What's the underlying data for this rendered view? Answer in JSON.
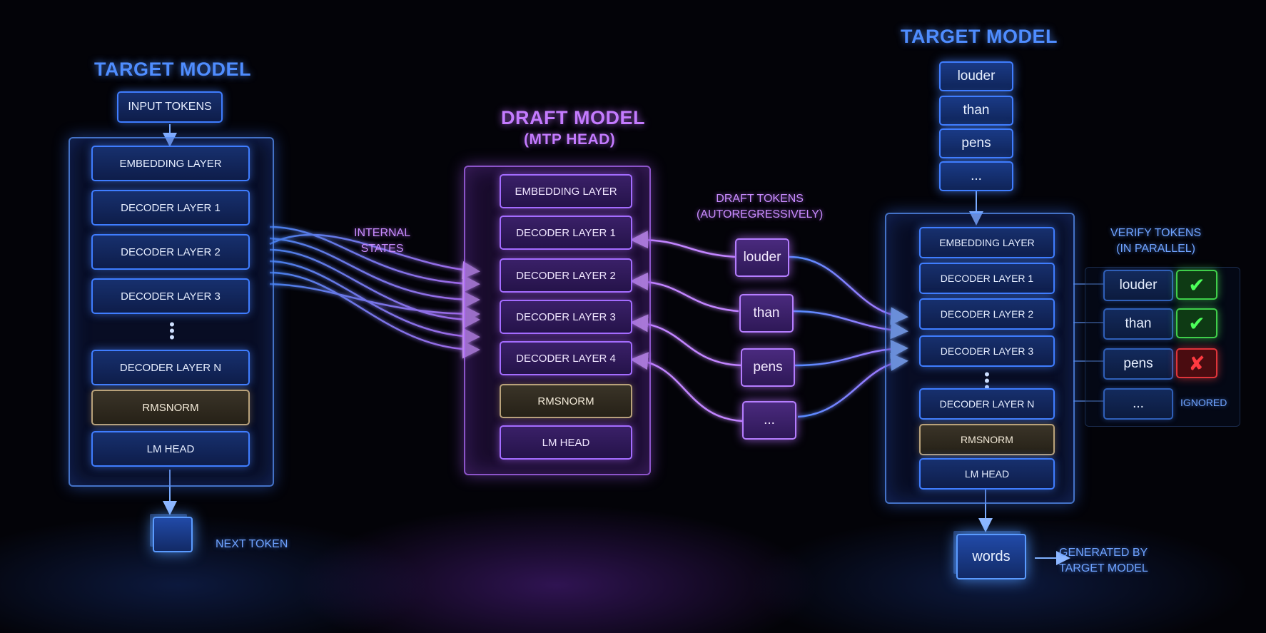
{
  "left_model": {
    "title": "TARGET MODEL",
    "input_label": "INPUT TOKENS",
    "layers": [
      "EMBEDDING LAYER",
      "DECODER LAYER 1",
      "DECODER LAYER 2",
      "DECODER LAYER 3",
      "DECODER LAYER N",
      "RMSNORM",
      "LM HEAD"
    ],
    "output_label": "NEXT TOKEN"
  },
  "internal_states_label": "INTERNAL\nSTATES",
  "draft_model": {
    "title": "DRAFT MODEL",
    "subtitle": "(MTP HEAD)",
    "layers": [
      "EMBEDDING LAYER",
      "DECODER LAYER 1",
      "DECODER LAYER 2",
      "DECODER LAYER 3",
      "DECODER LAYER 4",
      "RMSNORM",
      "LM HEAD"
    ]
  },
  "draft_tokens": {
    "label": "DRAFT TOKENS\n(AUTOREGRESSIVELY)",
    "tokens": [
      "louder",
      "than",
      "pens",
      "..."
    ]
  },
  "right_model": {
    "title": "TARGET MODEL",
    "input_tokens": [
      "louder",
      "than",
      "pens",
      "..."
    ],
    "layers": [
      "EMBEDDING LAYER",
      "DECODER LAYER 1",
      "DECODER LAYER 2",
      "DECODER LAYER 3",
      "DECODER LAYER N",
      "RMSNORM",
      "LM HEAD"
    ],
    "output_token": "words",
    "output_label": "GENERATED BY\nTARGET MODEL"
  },
  "verify": {
    "label": "VERIFY TOKENS\n(IN PARALLEL)",
    "rows": [
      {
        "token": "louder",
        "status": "accepted"
      },
      {
        "token": "than",
        "status": "accepted"
      },
      {
        "token": "pens",
        "status": "rejected"
      },
      {
        "token": "...",
        "status": "ignored",
        "note": "IGNORED"
      }
    ]
  },
  "colors": {
    "blue": "#3f7dff",
    "purple": "#a46cff",
    "accept": "#4cff5a",
    "reject": "#ff3a40"
  }
}
